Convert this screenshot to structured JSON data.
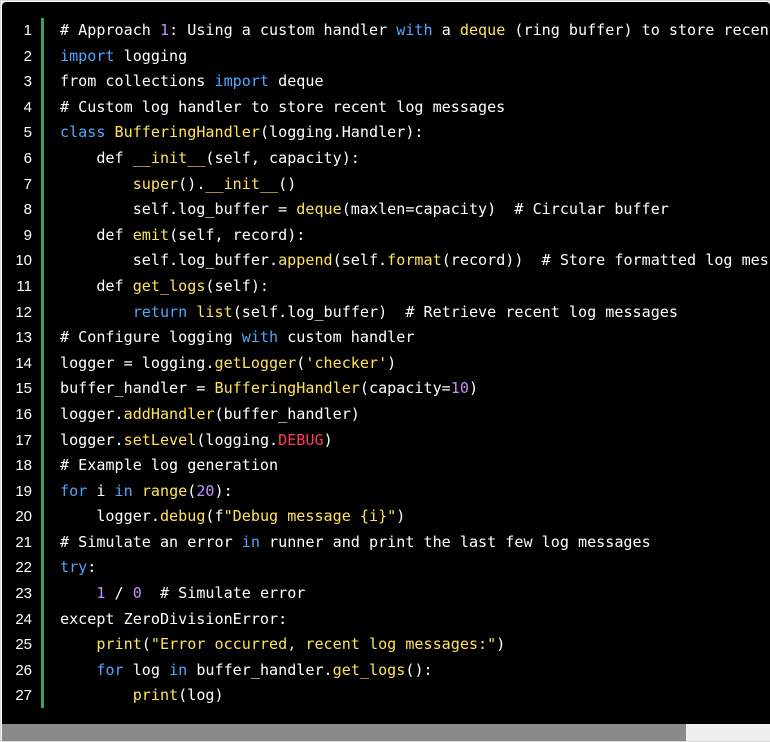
{
  "editor": {
    "line_numbers": [
      "1",
      "2",
      "3",
      "4",
      "5",
      "6",
      "7",
      "8",
      "9",
      "10",
      "11",
      "12",
      "13",
      "14",
      "15",
      "16",
      "17",
      "18",
      "19",
      "20",
      "21",
      "22",
      "23",
      "24",
      "25",
      "26",
      "27"
    ],
    "colors": {
      "background": "#000000",
      "accent_bar": "#3a9f6a",
      "keyword": "#4ea7ff",
      "function": "#ffe35a",
      "string": "#ffe35a",
      "number": "#c58cff",
      "constant": "#ff3b5c"
    },
    "lines": [
      [
        [
          "# Approach ",
          "cm"
        ],
        [
          "1",
          "num"
        ],
        [
          ": Using a custom handler ",
          "cm"
        ],
        [
          "with",
          "kw"
        ],
        [
          " a ",
          "cm"
        ],
        [
          "deque",
          "fn"
        ],
        [
          " (ring buffer) to store recent log messages",
          "cm"
        ]
      ],
      [
        [
          "import",
          "kw"
        ],
        [
          " logging",
          ""
        ]
      ],
      [
        [
          "from collections ",
          ""
        ],
        [
          "import",
          "kw"
        ],
        [
          " deque",
          ""
        ]
      ],
      [
        [
          "# Custom log handler to store recent log messages",
          "cm"
        ]
      ],
      [
        [
          "class",
          "kw"
        ],
        [
          " ",
          ""
        ],
        [
          "BufferingHandler",
          "fn"
        ],
        [
          "(logging.Handler):",
          ""
        ]
      ],
      [
        [
          "    def ",
          ""
        ],
        [
          "__init__",
          "fn"
        ],
        [
          "(self, capacity):",
          ""
        ]
      ],
      [
        [
          "        ",
          ""
        ],
        [
          "super",
          "fn"
        ],
        [
          "().",
          ""
        ],
        [
          "__init__",
          "fn"
        ],
        [
          "()",
          ""
        ]
      ],
      [
        [
          "        self.log_buffer = ",
          ""
        ],
        [
          "deque",
          "fn"
        ],
        [
          "(maxlen=capacity)  ",
          ""
        ],
        [
          "# Circular buffer",
          "cm"
        ]
      ],
      [
        [
          "    def ",
          ""
        ],
        [
          "emit",
          "fn"
        ],
        [
          "(self, record):",
          ""
        ]
      ],
      [
        [
          "        self.log_buffer.",
          ""
        ],
        [
          "append",
          "fn"
        ],
        [
          "(self.",
          ""
        ],
        [
          "format",
          "fn"
        ],
        [
          "(record))  ",
          ""
        ],
        [
          "# Store formatted log message",
          "cm"
        ]
      ],
      [
        [
          "    def ",
          ""
        ],
        [
          "get_logs",
          "fn"
        ],
        [
          "(self):",
          ""
        ]
      ],
      [
        [
          "        ",
          ""
        ],
        [
          "return",
          "kw"
        ],
        [
          " ",
          ""
        ],
        [
          "list",
          "fn"
        ],
        [
          "(self.log_buffer)  ",
          ""
        ],
        [
          "# Retrieve recent log messages",
          "cm"
        ]
      ],
      [
        [
          "# Configure logging ",
          "cm"
        ],
        [
          "with",
          "kw"
        ],
        [
          " custom handler",
          "cm"
        ]
      ],
      [
        [
          "logger = logging.",
          ""
        ],
        [
          "getLogger",
          "fn"
        ],
        [
          "(",
          ""
        ],
        [
          "'checker'",
          "str"
        ],
        [
          ")",
          ""
        ]
      ],
      [
        [
          "buffer_handler = ",
          ""
        ],
        [
          "BufferingHandler",
          "fn"
        ],
        [
          "(capacity=",
          ""
        ],
        [
          "10",
          "num"
        ],
        [
          ")",
          ""
        ]
      ],
      [
        [
          "logger.",
          ""
        ],
        [
          "addHandler",
          "fn"
        ],
        [
          "(buffer_handler)",
          ""
        ]
      ],
      [
        [
          "logger.",
          ""
        ],
        [
          "setLevel",
          "fn"
        ],
        [
          "(logging.",
          ""
        ],
        [
          "DEBUG",
          "const"
        ],
        [
          ")",
          ""
        ]
      ],
      [
        [
          "# Example log generation",
          "cm"
        ]
      ],
      [
        [
          "for",
          "kw"
        ],
        [
          " i ",
          ""
        ],
        [
          "in",
          "kw"
        ],
        [
          " ",
          ""
        ],
        [
          "range",
          "fn"
        ],
        [
          "(",
          ""
        ],
        [
          "20",
          "num"
        ],
        [
          "):",
          ""
        ]
      ],
      [
        [
          "    logger.",
          ""
        ],
        [
          "debug",
          "fn"
        ],
        [
          "(f",
          ""
        ],
        [
          "\"Debug message {i}\"",
          "str"
        ],
        [
          ")",
          ""
        ]
      ],
      [
        [
          "# Simulate an error ",
          "cm"
        ],
        [
          "in",
          "kw"
        ],
        [
          " runner and print the last few log messages",
          "cm"
        ]
      ],
      [
        [
          "try",
          "kw"
        ],
        [
          ":",
          ""
        ]
      ],
      [
        [
          "    ",
          ""
        ],
        [
          "1",
          "num"
        ],
        [
          " / ",
          ""
        ],
        [
          "0",
          "num"
        ],
        [
          "  ",
          ""
        ],
        [
          "# Simulate error",
          "cm"
        ]
      ],
      [
        [
          "except ZeroDivisionError:",
          ""
        ]
      ],
      [
        [
          "    ",
          ""
        ],
        [
          "print",
          "fn"
        ],
        [
          "(",
          ""
        ],
        [
          "\"Error occurred, recent log messages:\"",
          "str"
        ],
        [
          ")",
          ""
        ]
      ],
      [
        [
          "    ",
          ""
        ],
        [
          "for",
          "kw"
        ],
        [
          " log ",
          ""
        ],
        [
          "in",
          "kw"
        ],
        [
          " buffer_handler.",
          ""
        ],
        [
          "get_logs",
          "fn"
        ],
        [
          "():",
          ""
        ]
      ],
      [
        [
          "        ",
          ""
        ],
        [
          "print",
          "fn"
        ],
        [
          "(log)",
          ""
        ]
      ]
    ],
    "horizontal_scroll_position": 0.0,
    "horizontal_scroll_visible_fraction": 0.89
  }
}
